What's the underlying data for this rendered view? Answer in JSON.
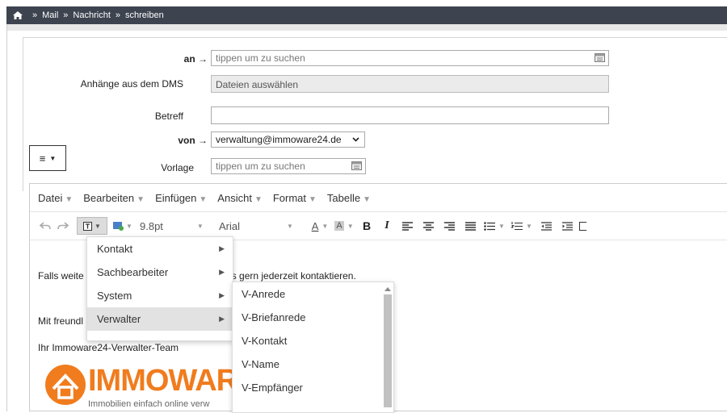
{
  "breadcrumb": [
    "Mail",
    "Nachricht",
    "schreiben"
  ],
  "form": {
    "to_label": "an",
    "to_placeholder": "tippen um zu suchen",
    "attachments_label": "Anhänge aus dem DMS",
    "attachments_button": "Dateien auswählen",
    "subject_label": "Betreff",
    "subject_value": "",
    "from_label": "von",
    "from_value": "verwaltung@immoware24.de",
    "template_label": "Vorlage",
    "template_placeholder": "tippen um zu suchen",
    "arrow": "→"
  },
  "editor": {
    "menus": [
      "Datei",
      "Bearbeiten",
      "Einfügen",
      "Ansicht",
      "Format",
      "Tabelle"
    ],
    "font_size": "9.8pt",
    "font_family": "Arial",
    "bold": "B",
    "italic": "I",
    "text_color": "A",
    "bg_color": "A",
    "body": {
      "line1_start": "Falls weite",
      "line1_end": "ie uns gern jederzeit kontaktieren.",
      "line2": "Mit freundl",
      "line3": "Ihr Immoware24-Verwalter-Team",
      "logo_text": "IMMOWARE",
      "logo_tagline": "Immobilien einfach online verw"
    }
  },
  "placeholder_menu": {
    "items": [
      {
        "label": "Kontakt"
      },
      {
        "label": "Sachbearbeiter"
      },
      {
        "label": "System"
      },
      {
        "label": "Verwalter"
      }
    ],
    "submenu": [
      "V-Anrede",
      "V-Briefanrede",
      "V-Kontakt",
      "V-Name",
      "V-Empfänger"
    ]
  },
  "colors": {
    "topbar": "#3d4450",
    "logo_orange": "#f07c1e"
  }
}
